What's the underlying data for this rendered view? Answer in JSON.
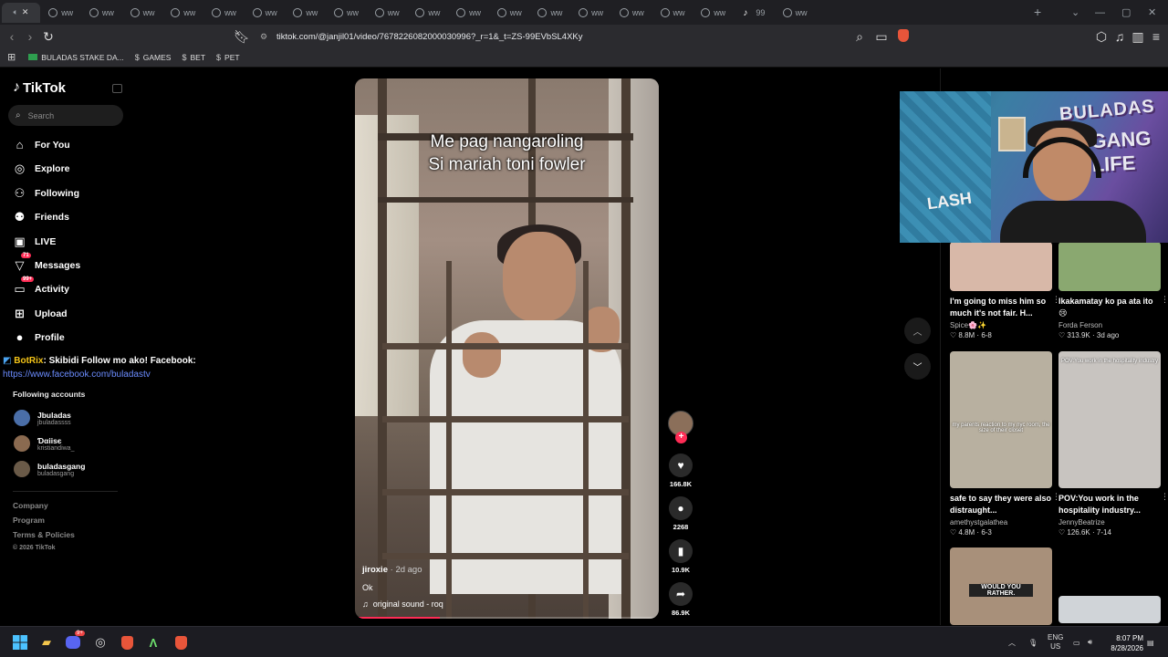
{
  "browser": {
    "tab_label": "ww",
    "tabs_count": 20,
    "active_tab_badge": "99",
    "url": "tiktok.com/@janjil01/video/7678226082000030996?_r=1&_t=ZS-99EVbSL4XKy",
    "bookmarks": [
      {
        "icon": "flag-icon",
        "label": "BULADAS STAKE DA..."
      },
      {
        "icon": "stake-icon",
        "label": "GAMES"
      },
      {
        "icon": "stake-icon",
        "label": "BET"
      },
      {
        "icon": "stake-icon",
        "label": "PET"
      }
    ]
  },
  "tiktok": {
    "logo": "TikTok",
    "search_placeholder": "Search",
    "nav": [
      {
        "icon": "home-icon",
        "label": "For You"
      },
      {
        "icon": "compass-icon",
        "label": "Explore"
      },
      {
        "icon": "following-icon",
        "label": "Following"
      },
      {
        "icon": "friends-icon",
        "label": "Friends"
      },
      {
        "icon": "live-icon",
        "label": "LIVE"
      },
      {
        "icon": "messages-icon",
        "label": "Messages",
        "badge": "71"
      },
      {
        "icon": "activity-icon",
        "label": "Activity",
        "badge": "99+"
      },
      {
        "icon": "upload-icon",
        "label": "Upload"
      },
      {
        "icon": "profile-icon",
        "label": "Profile"
      }
    ],
    "chat_overlay": {
      "bot": "BotRix",
      "message": ": Skibidi Follow mo ako! Facebook:",
      "link": "https://www.facebook.com/buladastv"
    },
    "following_title": "Following accounts",
    "following": [
      {
        "name": "Jbuladas",
        "handle": "jbuladassss",
        "color": "#4a6ea8"
      },
      {
        "name": "Ɗαiiѕє",
        "handle": "kristiandiwa_",
        "color": "#8a6a50"
      },
      {
        "name": "buladasgang",
        "handle": "buladasgang",
        "color": "#6a5a48"
      }
    ],
    "footer": [
      "Company",
      "Program",
      "Terms & Policies"
    ],
    "copyright": "© 2026 TikTok"
  },
  "video": {
    "caption_line1": "Me pag nangaroling",
    "caption_line2": "Si mariah toni fowler",
    "user": "jiroxie",
    "when": " · 2d ago",
    "description": "Ok",
    "sound": "original sound - roq",
    "progress": 0.28,
    "likes": "166.8K",
    "comments": "2268",
    "saves": "10.9K",
    "shares": "86.9K"
  },
  "grid": [
    {
      "title": "I'm going to miss him so much it's not fair. H...",
      "user": "Spice🌸✨",
      "views": "8.8M",
      "date": "6-8",
      "bg": "#d8b8a8"
    },
    {
      "title": "Ikakamatay ko pa ata ito 😢",
      "user": "Forda Ferson",
      "views": "313.9K",
      "date": "3d ago",
      "bg": "#8aa870"
    },
    {
      "title": "safe to say they were also distraught...",
      "user": "amethystgalathea",
      "views": "4.8M",
      "date": "6-3",
      "bg": "#b8b0a0",
      "overlay": "my parents reaction to my nyc room, the size of their closet"
    },
    {
      "title": "POV:You work in the hospitality industry...",
      "user": "JennyBeatrize",
      "views": "126.6K",
      "date": "7-14",
      "bg": "#c8c4c0",
      "overlay": "POV:You work in the hospitality industry"
    },
    {
      "title": "",
      "user": "",
      "views": "",
      "date": "",
      "bg": "#a8907a",
      "overlay": "WOULD YOU RATHER."
    },
    {
      "title": "",
      "user": "",
      "views": "",
      "date": "",
      "bg": "#d0d4d8"
    }
  ],
  "webcam": {
    "text1": "BULADAS",
    "text2": "GANG LIFE",
    "text3": "LASH"
  },
  "taskbar": {
    "lang": "ENG",
    "region": "US",
    "time": "8:07 PM",
    "date": "8/28/2026",
    "discord_badge": "9+"
  }
}
